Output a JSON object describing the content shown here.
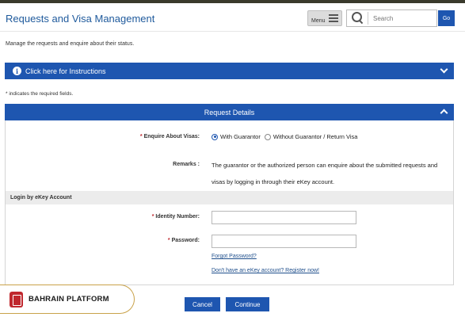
{
  "header": {
    "title": "Requests and Visa Management",
    "menu_label": "Menu",
    "search_placeholder": "Search",
    "go_label": "Go"
  },
  "subtitle": "Manage the requests and enquire about their status.",
  "instructions": {
    "label": "Click here for Instructions"
  },
  "required_note": "* indicates the required fields.",
  "request_details": {
    "title": "Request Details",
    "enquire_label": "Enquire About Visas:",
    "options": [
      {
        "label": "With Guarantor",
        "selected": true
      },
      {
        "label": "Without Guarantor / Return Visa",
        "selected": false
      }
    ],
    "remarks_label": "Remarks :",
    "remarks_text": "The guarantor or the authorized person can enquire about the submitted requests and visas by logging in through their eKey account."
  },
  "login": {
    "section_title": "Login by eKey Account",
    "identity_label": "Identity Number:",
    "identity_value": "",
    "password_label": "Password:",
    "password_value": "",
    "forgot_link": "Forgot Password?",
    "register_link": "Don't have an eKey account? Register now!"
  },
  "actions": {
    "cancel": "Cancel",
    "continue": "Continue"
  },
  "badge": {
    "text": "BAHRAIN PLATFORM"
  },
  "colors": {
    "primary": "#1e56b0",
    "title": "#1f5a9c",
    "required": "#c0272d",
    "badge_border": "#c9a24a"
  },
  "icons": {
    "menu": "hamburger-icon",
    "search": "search-icon",
    "info": "info-icon",
    "collapse": "chevron-icon",
    "badge": "bahrain-platform-logo-icon"
  }
}
